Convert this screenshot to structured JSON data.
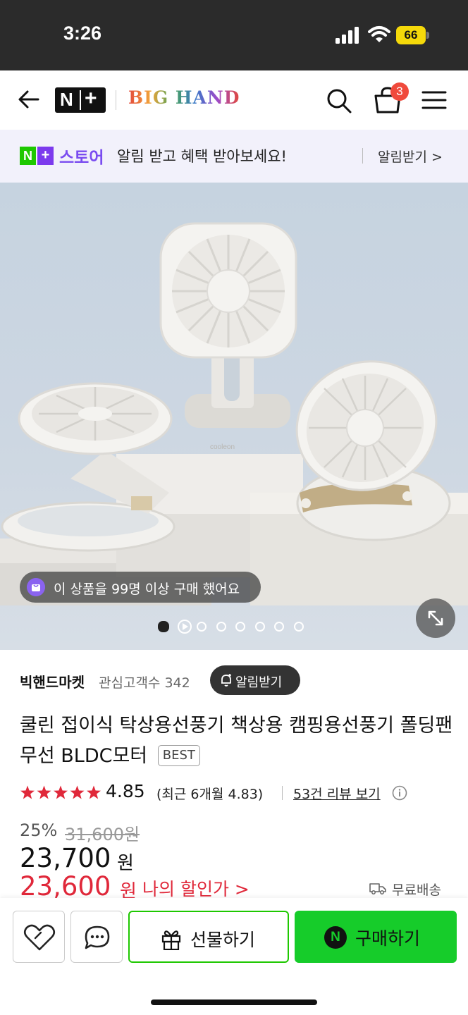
{
  "status_bar": {
    "time": "3:26",
    "battery": "66"
  },
  "header": {
    "brand": "BIG HAND",
    "cart_count": "3",
    "nplus_n": "N",
    "nplus_plus": "+"
  },
  "banner": {
    "badge_n": "N",
    "badge_plus": "+",
    "store": "스토어",
    "message": "알림 받고 혜택 받아보세요!",
    "notify_label": "알림받기 >"
  },
  "gallery": {
    "buyers_text": "이 상품을 99명 이상 구매 했어요",
    "image_count": 8,
    "current_index": 0,
    "image_label": "cooleon"
  },
  "seller": {
    "name": "빅핸드마켓",
    "interest": "관심고객수 342",
    "notify_button": "알림받기"
  },
  "product": {
    "title": "쿨린 접이식 탁상용선풍기 책상용 캠핑용선풍기 폴딩팬 무선 BLDC모터",
    "badge": "BEST",
    "rating": "4.85",
    "rating_stars": 5,
    "recent_rating": "(최근 6개월 4.83)",
    "reviews": "53건 리뷰 보기",
    "discount": "25%",
    "original_price": "31,600원",
    "price": "23,700",
    "price_unit": "원",
    "my_price": "23,600",
    "my_price_unit": "원",
    "my_price_label": "나의 할인가 >",
    "shipping": "무료배송"
  },
  "bottom_bar": {
    "gift_label": "선물하기",
    "buy_label": "구매하기",
    "buy_n": "N"
  },
  "colors": {
    "naver_green": "#16cc2a",
    "accent_purple": "#7a4cf0",
    "sale_red": "#e0283a",
    "badge_red": "#f04a3c"
  }
}
